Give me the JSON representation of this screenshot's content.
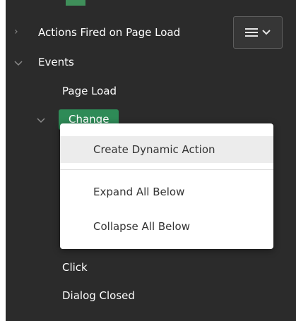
{
  "header": {
    "actions_fired_label": "Actions Fired on Page Load",
    "menu_button_icon": "hamburger-menu-icon"
  },
  "tree": {
    "events_label": "Events",
    "page_load_label": "Page Load",
    "change_label": "Change",
    "click_label": "Click",
    "dialog_closed_label": "Dialog Closed"
  },
  "context_menu": {
    "items": [
      {
        "label": "Create Dynamic Action"
      },
      {
        "label": "Expand All Below"
      },
      {
        "label": "Collapse All Below"
      }
    ]
  },
  "colors": {
    "panel_bg": "#2b2b2b",
    "accent_green": "#2e8b57",
    "menu_bg": "#ffffff"
  }
}
